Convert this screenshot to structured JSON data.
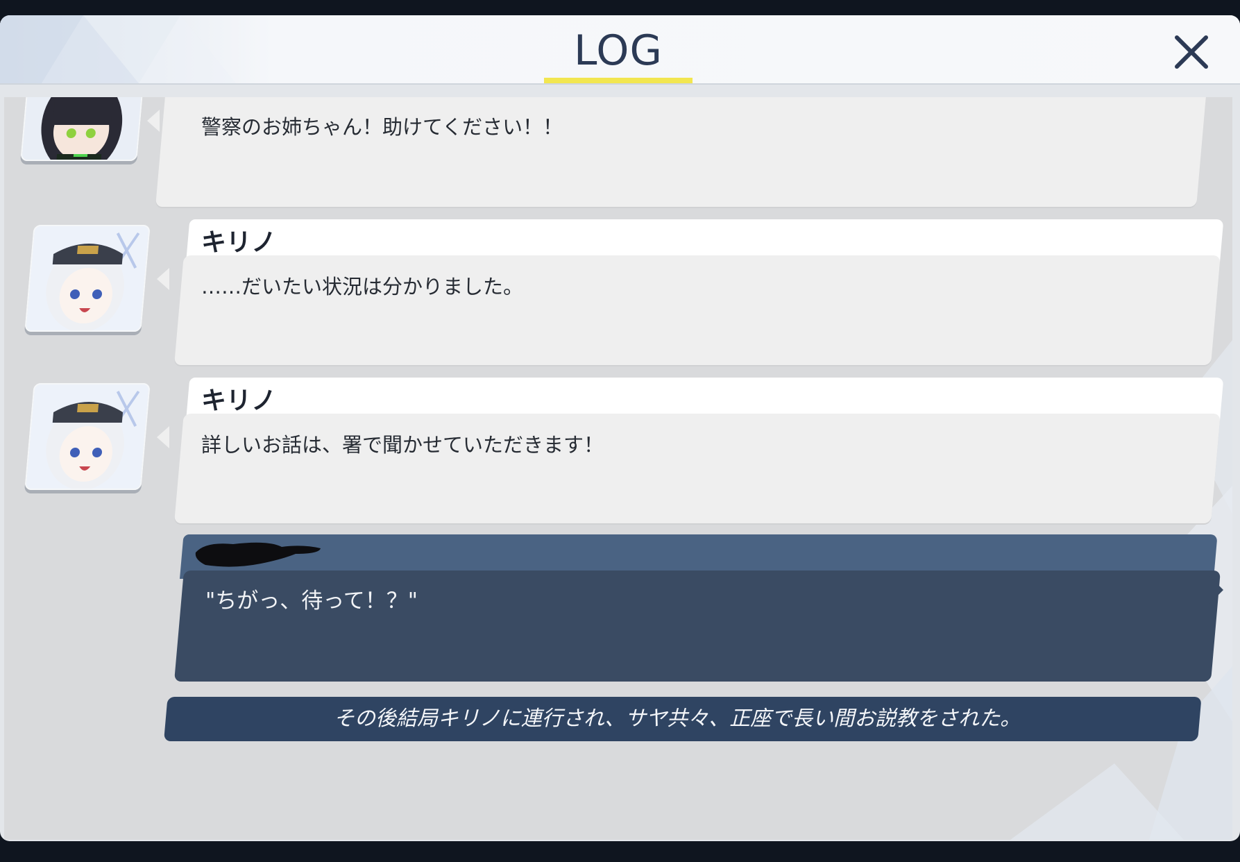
{
  "header": {
    "title": "LOG",
    "close_icon": "close-icon"
  },
  "colors": {
    "title": "#2c3a55",
    "title_underline": "#f2e650",
    "player_name_bg": "#4a6383",
    "player_bubble_bg": "#3a4b63",
    "narration_bg": "#2f4462",
    "npc_bubble_bg": "#efefef"
  },
  "entries": [
    {
      "type": "character",
      "speaker": "",
      "avatar": "dark-haired-girl-avatar",
      "text": "警察のお姉ちゃん！助けてください！！"
    },
    {
      "type": "character",
      "speaker": "キリノ",
      "avatar": "kirino-avatar",
      "text": "……だいたい状況は分かりました。"
    },
    {
      "type": "character",
      "speaker": "キリノ",
      "avatar": "kirino-avatar",
      "text": "詳しいお話は、署で聞かせていただきます！"
    },
    {
      "type": "player",
      "speaker_redacted": true,
      "text": "\"ちがっ、待って！？\""
    },
    {
      "type": "narration",
      "text": "その後結局キリノに連行され、サヤ共々、正座で長い間お説教をされた。"
    }
  ]
}
